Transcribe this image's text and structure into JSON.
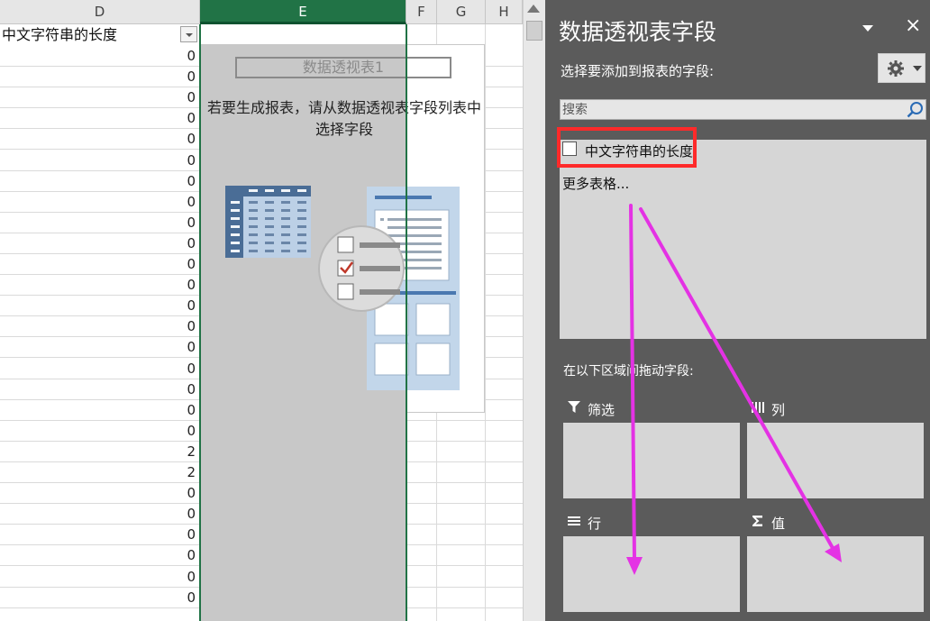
{
  "sheet": {
    "columns": [
      {
        "name": "D"
      },
      {
        "name": "E"
      },
      {
        "name": "F"
      },
      {
        "name": "G"
      },
      {
        "name": "H"
      }
    ],
    "d_header_value": "中文字符串的长度",
    "d_values": [
      "0",
      "0",
      "0",
      "0",
      "0",
      "0",
      "0",
      "0",
      "0",
      "0",
      "0",
      "0",
      "0",
      "0",
      "0",
      "0",
      "0",
      "0",
      "0",
      "2",
      "2",
      "0",
      "0",
      "0",
      "0",
      "0",
      "0"
    ]
  },
  "pivot": {
    "title": "数据透视表1",
    "hint": "若要生成报表，请从数据透视表字段列表中选择字段"
  },
  "panel": {
    "title": "数据透视表字段",
    "close": "×",
    "subtitle": "选择要添加到报表的字段:",
    "search_placeholder": "搜索",
    "field_label": "中文字符串的长度",
    "more_tables": "更多表格...",
    "area_hint": "在以下区域间拖动字段:",
    "areas": {
      "filter": "筛选",
      "columns": "列",
      "rows": "行",
      "values": "值"
    }
  },
  "colors": {
    "excel_green": "#217346",
    "panel_bg": "#5b5b5b",
    "highlight_red": "#ff2a2a",
    "arrow_magenta": "#e432e4"
  }
}
